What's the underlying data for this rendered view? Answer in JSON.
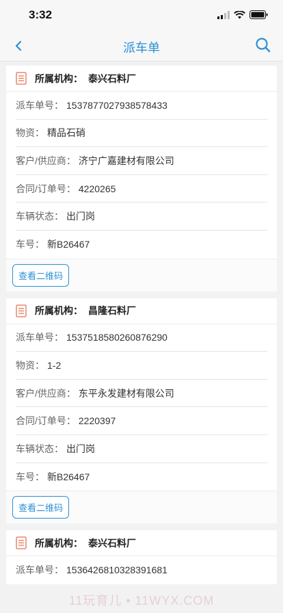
{
  "status": {
    "time": "3:32"
  },
  "nav": {
    "title": "派车单"
  },
  "labels": {
    "org": "所属机构：",
    "dispatch_no": "派车单号：",
    "material": "物资：",
    "customer": "客户/供应商：",
    "contract": "合同/订单号：",
    "vehicle_status": "车辆状态：",
    "plate": "车号：",
    "qr_button": "查看二维码"
  },
  "cards": [
    {
      "org": "泰兴石料厂",
      "dispatch_no": "1537877027938578433",
      "material": "精品石硝",
      "customer": "济宁广嘉建材有限公司",
      "contract": "4220265",
      "vehicle_status": "出门岗",
      "plate": "新B26467"
    },
    {
      "org": "昌隆石料厂",
      "dispatch_no": "1537518580260876290",
      "material": "1-2",
      "customer": "东平永发建材有限公司",
      "contract": "2220397",
      "vehicle_status": "出门岗",
      "plate": "新B26467"
    },
    {
      "org": "泰兴石料厂",
      "dispatch_no": "1536426810328391681"
    }
  ],
  "watermark": "11玩育儿 • 11WYX.COM",
  "colors": {
    "accent": "#2a8fd8",
    "doc_icon": "#e8704f"
  }
}
